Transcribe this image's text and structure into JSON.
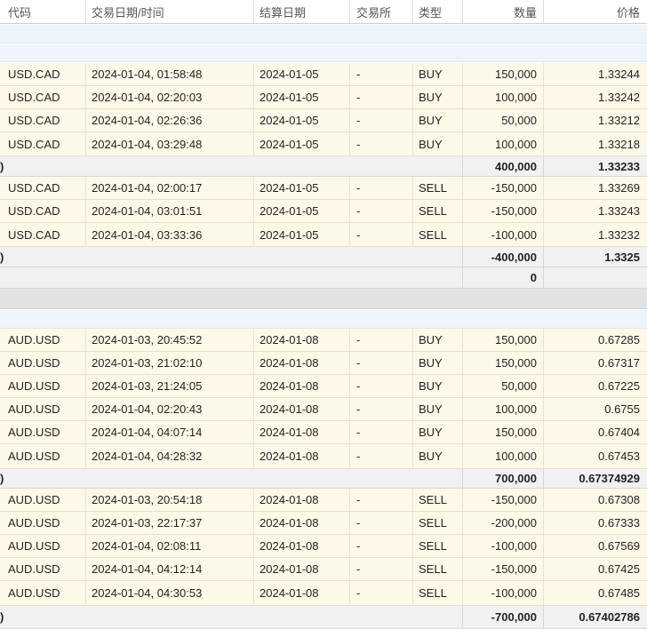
{
  "columns": {
    "symbol": "代码",
    "datetime": "交易日期/时间",
    "settle": "结算日期",
    "exchange": "交易所",
    "type": "类型",
    "quantity": "数量",
    "price": "价格"
  },
  "subtotal_marker": ")",
  "usdcad": {
    "buys": [
      {
        "symbol": "USD.CAD",
        "datetime": "2024-01-04, 01:58:48",
        "settle": "2024-01-05",
        "exchange": "-",
        "type": "BUY",
        "quantity": "150,000",
        "price": "1.33244"
      },
      {
        "symbol": "USD.CAD",
        "datetime": "2024-01-04, 02:20:03",
        "settle": "2024-01-05",
        "exchange": "-",
        "type": "BUY",
        "quantity": "100,000",
        "price": "1.33242"
      },
      {
        "symbol": "USD.CAD",
        "datetime": "2024-01-04, 02:26:36",
        "settle": "2024-01-05",
        "exchange": "-",
        "type": "BUY",
        "quantity": "50,000",
        "price": "1.33212"
      },
      {
        "symbol": "USD.CAD",
        "datetime": "2024-01-04, 03:29:48",
        "settle": "2024-01-05",
        "exchange": "-",
        "type": "BUY",
        "quantity": "100,000",
        "price": "1.33218"
      }
    ],
    "buy_total": {
      "quantity": "400,000",
      "price": "1.33233"
    },
    "sells": [
      {
        "symbol": "USD.CAD",
        "datetime": "2024-01-04, 02:00:17",
        "settle": "2024-01-05",
        "exchange": "-",
        "type": "SELL",
        "quantity": "-150,000",
        "price": "1.33269"
      },
      {
        "symbol": "USD.CAD",
        "datetime": "2024-01-04, 03:01:51",
        "settle": "2024-01-05",
        "exchange": "-",
        "type": "SELL",
        "quantity": "-150,000",
        "price": "1.33243"
      },
      {
        "symbol": "USD.CAD",
        "datetime": "2024-01-04, 03:33:36",
        "settle": "2024-01-05",
        "exchange": "-",
        "type": "SELL",
        "quantity": "-100,000",
        "price": "1.33232"
      }
    ],
    "sell_total": {
      "quantity": "-400,000",
      "price": "1.3325"
    },
    "net": {
      "quantity": "0"
    }
  },
  "audusd": {
    "buys": [
      {
        "symbol": "AUD.USD",
        "datetime": "2024-01-03, 20:45:52",
        "settle": "2024-01-08",
        "exchange": "-",
        "type": "BUY",
        "quantity": "150,000",
        "price": "0.67285"
      },
      {
        "symbol": "AUD.USD",
        "datetime": "2024-01-03, 21:02:10",
        "settle": "2024-01-08",
        "exchange": "-",
        "type": "BUY",
        "quantity": "150,000",
        "price": "0.67317"
      },
      {
        "symbol": "AUD.USD",
        "datetime": "2024-01-03, 21:24:05",
        "settle": "2024-01-08",
        "exchange": "-",
        "type": "BUY",
        "quantity": "50,000",
        "price": "0.67225"
      },
      {
        "symbol": "AUD.USD",
        "datetime": "2024-01-04, 02:20:43",
        "settle": "2024-01-08",
        "exchange": "-",
        "type": "BUY",
        "quantity": "100,000",
        "price": "0.6755"
      },
      {
        "symbol": "AUD.USD",
        "datetime": "2024-01-04, 04:07:14",
        "settle": "2024-01-08",
        "exchange": "-",
        "type": "BUY",
        "quantity": "150,000",
        "price": "0.67404"
      },
      {
        "symbol": "AUD.USD",
        "datetime": "2024-01-04, 04:28:32",
        "settle": "2024-01-08",
        "exchange": "-",
        "type": "BUY",
        "quantity": "100,000",
        "price": "0.67453"
      }
    ],
    "buy_total": {
      "quantity": "700,000",
      "price": "0.67374929"
    },
    "sells": [
      {
        "symbol": "AUD.USD",
        "datetime": "2024-01-03, 20:54:18",
        "settle": "2024-01-08",
        "exchange": "-",
        "type": "SELL",
        "quantity": "-150,000",
        "price": "0.67308"
      },
      {
        "symbol": "AUD.USD",
        "datetime": "2024-01-03, 22:17:37",
        "settle": "2024-01-08",
        "exchange": "-",
        "type": "SELL",
        "quantity": "-200,000",
        "price": "0.67333"
      },
      {
        "symbol": "AUD.USD",
        "datetime": "2024-01-04, 02:08:11",
        "settle": "2024-01-08",
        "exchange": "-",
        "type": "SELL",
        "quantity": "-100,000",
        "price": "0.67569"
      },
      {
        "symbol": "AUD.USD",
        "datetime": "2024-01-04, 04:12:14",
        "settle": "2024-01-08",
        "exchange": "-",
        "type": "SELL",
        "quantity": "-150,000",
        "price": "0.67425"
      },
      {
        "symbol": "AUD.USD",
        "datetime": "2024-01-04, 04:30:53",
        "settle": "2024-01-08",
        "exchange": "-",
        "type": "SELL",
        "quantity": "-100,000",
        "price": "0.67485"
      }
    ],
    "sell_total": {
      "quantity": "-700,000",
      "price": "0.67402786"
    }
  },
  "colors": {
    "trade_row_bg": "#fdf9e9",
    "subtotal_bg": "#f1f1f1",
    "section_band": "#eef4fb",
    "divider_band": "#e2e2e2"
  }
}
